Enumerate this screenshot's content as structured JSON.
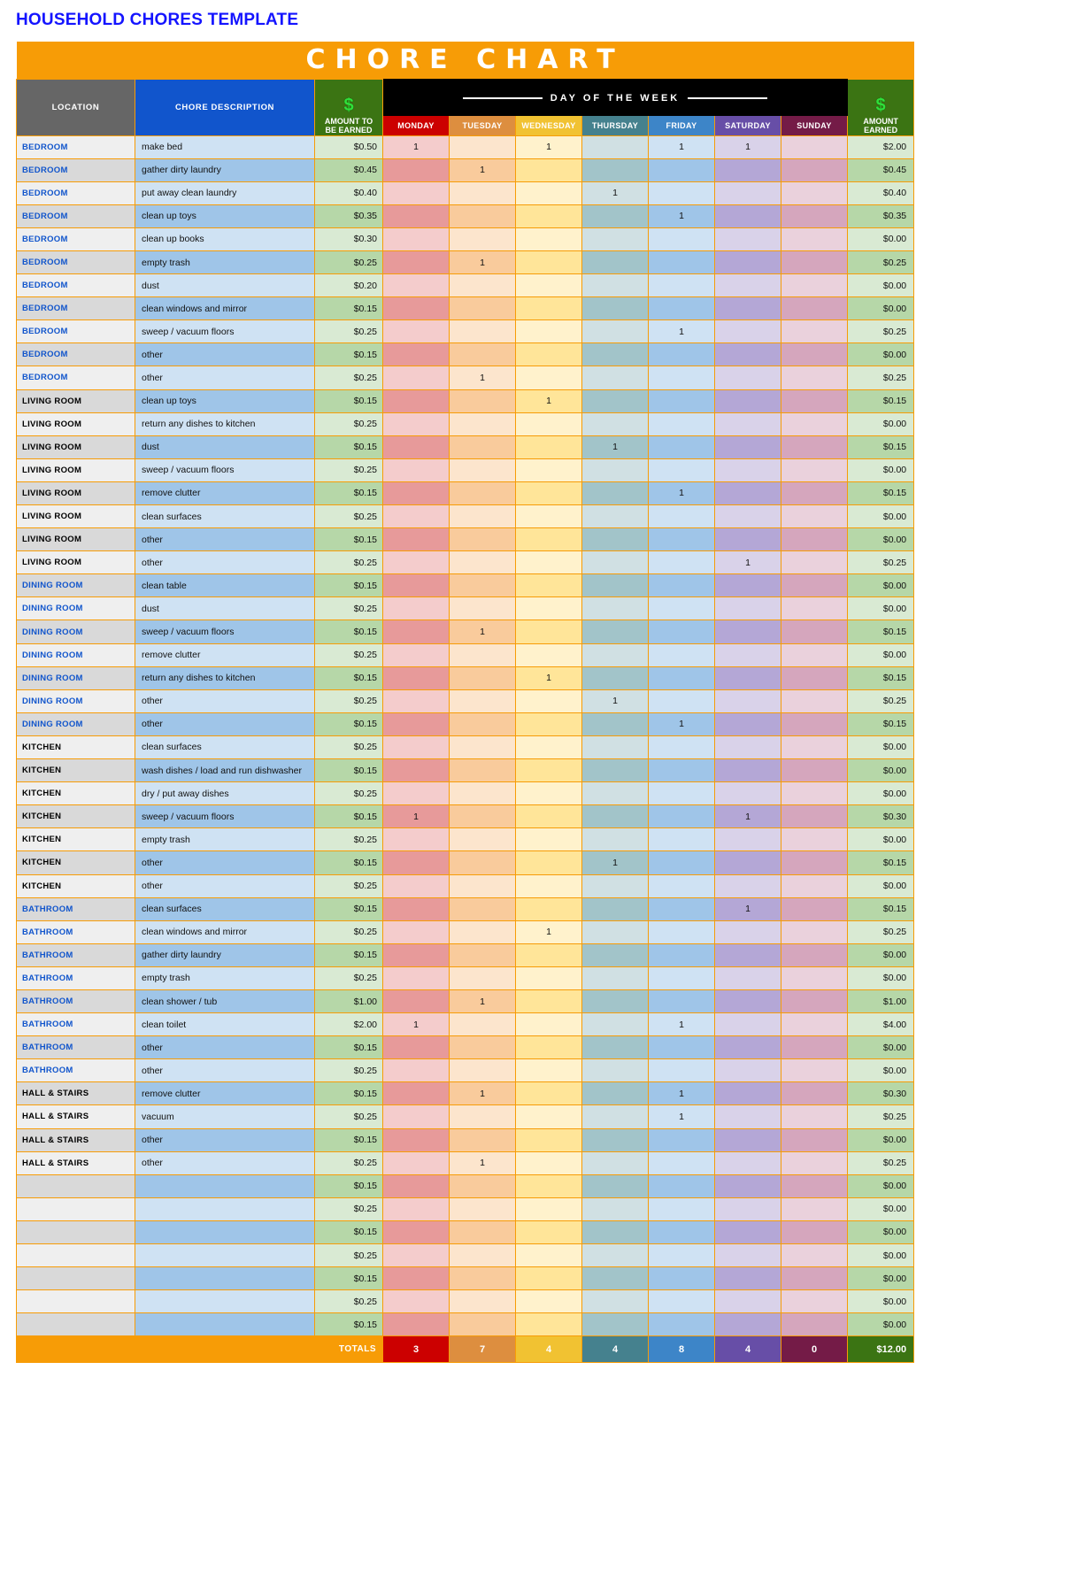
{
  "doc_title": "HOUSEHOLD CHORES TEMPLATE",
  "banner": {
    "title": "CHORE CHART",
    "background": "#f79c06"
  },
  "header": {
    "location": "LOCATION",
    "chore_description": "CHORE DESCRIPTION",
    "amount_to_be_earned_icon": "dollar-sign",
    "amount_to_be_earned_line1": "AMOUNT TO",
    "amount_to_be_earned_line2": "BE EARNED",
    "day_of_week_band": "DAY OF THE WEEK",
    "amount_earned_icon": "dollar-sign",
    "amount_earned_line1": "AMOUNT",
    "amount_earned_line2": "EARNED",
    "days": [
      {
        "label": "MONDAY",
        "color": "#cc0000"
      },
      {
        "label": "TUESDAY",
        "color": "#dd8e3f"
      },
      {
        "label": "WEDNESDAY",
        "color": "#f1c232"
      },
      {
        "label": "THURSDAY",
        "color": "#45818e"
      },
      {
        "label": "FRIDAY",
        "color": "#3d85c8"
      },
      {
        "label": "SATURDAY",
        "color": "#674ea7"
      },
      {
        "label": "SUNDAY",
        "color": "#741b47"
      }
    ]
  },
  "colors": {
    "title_blue": "#1414ff",
    "orange": "#f79c06",
    "grey_header": "#666666",
    "blue_header": "#1155cc",
    "green_header": "#3b7413",
    "black_band": "#000000"
  },
  "rows": [
    {
      "location": "BEDROOM",
      "loc_color": "#1155cc",
      "desc": "make bed",
      "amount": "$0.50",
      "days": [
        "1",
        "",
        "1",
        "",
        "1",
        "1",
        ""
      ],
      "earned": "$2.00"
    },
    {
      "location": "BEDROOM",
      "loc_color": "#1155cc",
      "desc": "gather dirty laundry",
      "amount": "$0.45",
      "days": [
        "",
        "1",
        "",
        "",
        "",
        "",
        ""
      ],
      "earned": "$0.45"
    },
    {
      "location": "BEDROOM",
      "loc_color": "#1155cc",
      "desc": "put away clean laundry",
      "amount": "$0.40",
      "days": [
        "",
        "",
        "",
        "1",
        "",
        "",
        ""
      ],
      "earned": "$0.40"
    },
    {
      "location": "BEDROOM",
      "loc_color": "#1155cc",
      "desc": "clean up toys",
      "amount": "$0.35",
      "days": [
        "",
        "",
        "",
        "",
        "1",
        "",
        ""
      ],
      "earned": "$0.35"
    },
    {
      "location": "BEDROOM",
      "loc_color": "#1155cc",
      "desc": "clean up books",
      "amount": "$0.30",
      "days": [
        "",
        "",
        "",
        "",
        "",
        "",
        ""
      ],
      "earned": "$0.00"
    },
    {
      "location": "BEDROOM",
      "loc_color": "#1155cc",
      "desc": "empty trash",
      "amount": "$0.25",
      "days": [
        "",
        "1",
        "",
        "",
        "",
        "",
        ""
      ],
      "earned": "$0.25"
    },
    {
      "location": "BEDROOM",
      "loc_color": "#1155cc",
      "desc": "dust",
      "amount": "$0.20",
      "days": [
        "",
        "",
        "",
        "",
        "",
        "",
        ""
      ],
      "earned": "$0.00"
    },
    {
      "location": "BEDROOM",
      "loc_color": "#1155cc",
      "desc": "clean windows and mirror",
      "amount": "$0.15",
      "days": [
        "",
        "",
        "",
        "",
        "",
        "",
        ""
      ],
      "earned": "$0.00"
    },
    {
      "location": "BEDROOM",
      "loc_color": "#1155cc",
      "desc": "sweep / vacuum floors",
      "amount": "$0.25",
      "days": [
        "",
        "",
        "",
        "",
        "1",
        "",
        ""
      ],
      "earned": "$0.25"
    },
    {
      "location": "BEDROOM",
      "loc_color": "#1155cc",
      "desc": "other",
      "amount": "$0.15",
      "days": [
        "",
        "",
        "",
        "",
        "",
        "",
        ""
      ],
      "earned": "$0.00"
    },
    {
      "location": "BEDROOM",
      "loc_color": "#1155cc",
      "desc": "other",
      "amount": "$0.25",
      "days": [
        "",
        "1",
        "",
        "",
        "",
        "",
        ""
      ],
      "earned": "$0.25"
    },
    {
      "location": "LIVING ROOM",
      "loc_color": "#000000",
      "desc": "clean up toys",
      "amount": "$0.15",
      "days": [
        "",
        "",
        "1",
        "",
        "",
        "",
        ""
      ],
      "earned": "$0.15"
    },
    {
      "location": "LIVING ROOM",
      "loc_color": "#000000",
      "desc": "return any dishes to kitchen",
      "amount": "$0.25",
      "days": [
        "",
        "",
        "",
        "",
        "",
        "",
        ""
      ],
      "earned": "$0.00"
    },
    {
      "location": "LIVING ROOM",
      "loc_color": "#000000",
      "desc": "dust",
      "amount": "$0.15",
      "days": [
        "",
        "",
        "",
        "1",
        "",
        "",
        ""
      ],
      "earned": "$0.15"
    },
    {
      "location": "LIVING ROOM",
      "loc_color": "#000000",
      "desc": "sweep / vacuum floors",
      "amount": "$0.25",
      "days": [
        "",
        "",
        "",
        "",
        "",
        "",
        ""
      ],
      "earned": "$0.00"
    },
    {
      "location": "LIVING ROOM",
      "loc_color": "#000000",
      "desc": "remove clutter",
      "amount": "$0.15",
      "days": [
        "",
        "",
        "",
        "",
        "1",
        "",
        ""
      ],
      "earned": "$0.15"
    },
    {
      "location": "LIVING ROOM",
      "loc_color": "#000000",
      "desc": "clean surfaces",
      "amount": "$0.25",
      "days": [
        "",
        "",
        "",
        "",
        "",
        "",
        ""
      ],
      "earned": "$0.00"
    },
    {
      "location": "LIVING ROOM",
      "loc_color": "#000000",
      "desc": "other",
      "amount": "$0.15",
      "days": [
        "",
        "",
        "",
        "",
        "",
        "",
        ""
      ],
      "earned": "$0.00"
    },
    {
      "location": "LIVING ROOM",
      "loc_color": "#000000",
      "desc": "other",
      "amount": "$0.25",
      "days": [
        "",
        "",
        "",
        "",
        "",
        "1",
        ""
      ],
      "earned": "$0.25"
    },
    {
      "location": "DINING ROOM",
      "loc_color": "#1155cc",
      "desc": "clean table",
      "amount": "$0.15",
      "days": [
        "",
        "",
        "",
        "",
        "",
        "",
        ""
      ],
      "earned": "$0.00"
    },
    {
      "location": "DINING ROOM",
      "loc_color": "#1155cc",
      "desc": "dust",
      "amount": "$0.25",
      "days": [
        "",
        "",
        "",
        "",
        "",
        "",
        ""
      ],
      "earned": "$0.00"
    },
    {
      "location": "DINING ROOM",
      "loc_color": "#1155cc",
      "desc": "sweep / vacuum floors",
      "amount": "$0.15",
      "days": [
        "",
        "1",
        "",
        "",
        "",
        "",
        ""
      ],
      "earned": "$0.15"
    },
    {
      "location": "DINING ROOM",
      "loc_color": "#1155cc",
      "desc": "remove clutter",
      "amount": "$0.25",
      "days": [
        "",
        "",
        "",
        "",
        "",
        "",
        ""
      ],
      "earned": "$0.00"
    },
    {
      "location": "DINING ROOM",
      "loc_color": "#1155cc",
      "desc": "return any dishes to kitchen",
      "amount": "$0.15",
      "days": [
        "",
        "",
        "1",
        "",
        "",
        "",
        ""
      ],
      "earned": "$0.15"
    },
    {
      "location": "DINING ROOM",
      "loc_color": "#1155cc",
      "desc": "other",
      "amount": "$0.25",
      "days": [
        "",
        "",
        "",
        "1",
        "",
        "",
        ""
      ],
      "earned": "$0.25"
    },
    {
      "location": "DINING ROOM",
      "loc_color": "#1155cc",
      "desc": "other",
      "amount": "$0.15",
      "days": [
        "",
        "",
        "",
        "",
        "1",
        "",
        ""
      ],
      "earned": "$0.15"
    },
    {
      "location": "KITCHEN",
      "loc_color": "#000000",
      "desc": "clean surfaces",
      "amount": "$0.25",
      "days": [
        "",
        "",
        "",
        "",
        "",
        "",
        ""
      ],
      "earned": "$0.00"
    },
    {
      "location": "KITCHEN",
      "loc_color": "#000000",
      "desc": "wash dishes / load and run dishwasher",
      "amount": "$0.15",
      "days": [
        "",
        "",
        "",
        "",
        "",
        "",
        ""
      ],
      "earned": "$0.00"
    },
    {
      "location": "KITCHEN",
      "loc_color": "#000000",
      "desc": "dry / put away dishes",
      "amount": "$0.25",
      "days": [
        "",
        "",
        "",
        "",
        "",
        "",
        ""
      ],
      "earned": "$0.00"
    },
    {
      "location": "KITCHEN",
      "loc_color": "#000000",
      "desc": "sweep / vacuum floors",
      "amount": "$0.15",
      "days": [
        "1",
        "",
        "",
        "",
        "",
        "1",
        ""
      ],
      "earned": "$0.30"
    },
    {
      "location": "KITCHEN",
      "loc_color": "#000000",
      "desc": "empty trash",
      "amount": "$0.25",
      "days": [
        "",
        "",
        "",
        "",
        "",
        "",
        ""
      ],
      "earned": "$0.00"
    },
    {
      "location": "KITCHEN",
      "loc_color": "#000000",
      "desc": "other",
      "amount": "$0.15",
      "days": [
        "",
        "",
        "",
        "1",
        "",
        "",
        ""
      ],
      "earned": "$0.15"
    },
    {
      "location": "KITCHEN",
      "loc_color": "#000000",
      "desc": "other",
      "amount": "$0.25",
      "days": [
        "",
        "",
        "",
        "",
        "",
        "",
        ""
      ],
      "earned": "$0.00"
    },
    {
      "location": "BATHROOM",
      "loc_color": "#1155cc",
      "desc": "clean surfaces",
      "amount": "$0.15",
      "days": [
        "",
        "",
        "",
        "",
        "",
        "1",
        ""
      ],
      "earned": "$0.15"
    },
    {
      "location": "BATHROOM",
      "loc_color": "#1155cc",
      "desc": "clean windows and mirror",
      "amount": "$0.25",
      "days": [
        "",
        "",
        "1",
        "",
        "",
        "",
        ""
      ],
      "earned": "$0.25"
    },
    {
      "location": "BATHROOM",
      "loc_color": "#1155cc",
      "desc": "gather dirty laundry",
      "amount": "$0.15",
      "days": [
        "",
        "",
        "",
        "",
        "",
        "",
        ""
      ],
      "earned": "$0.00"
    },
    {
      "location": "BATHROOM",
      "loc_color": "#1155cc",
      "desc": "empty trash",
      "amount": "$0.25",
      "days": [
        "",
        "",
        "",
        "",
        "",
        "",
        ""
      ],
      "earned": "$0.00"
    },
    {
      "location": "BATHROOM",
      "loc_color": "#1155cc",
      "desc": "clean shower / tub",
      "amount": "$1.00",
      "days": [
        "",
        "1",
        "",
        "",
        "",
        "",
        ""
      ],
      "earned": "$1.00"
    },
    {
      "location": "BATHROOM",
      "loc_color": "#1155cc",
      "desc": "clean toilet",
      "amount": "$2.00",
      "days": [
        "1",
        "",
        "",
        "",
        "1",
        "",
        ""
      ],
      "earned": "$4.00"
    },
    {
      "location": "BATHROOM",
      "loc_color": "#1155cc",
      "desc": "other",
      "amount": "$0.15",
      "days": [
        "",
        "",
        "",
        "",
        "",
        "",
        ""
      ],
      "earned": "$0.00"
    },
    {
      "location": "BATHROOM",
      "loc_color": "#1155cc",
      "desc": "other",
      "amount": "$0.25",
      "days": [
        "",
        "",
        "",
        "",
        "",
        "",
        ""
      ],
      "earned": "$0.00"
    },
    {
      "location": "HALL & STAIRS",
      "loc_color": "#000000",
      "desc": "remove clutter",
      "amount": "$0.15",
      "days": [
        "",
        "1",
        "",
        "",
        "1",
        "",
        ""
      ],
      "earned": "$0.30"
    },
    {
      "location": "HALL & STAIRS",
      "loc_color": "#000000",
      "desc": "vacuum",
      "amount": "$0.25",
      "days": [
        "",
        "",
        "",
        "",
        "1",
        "",
        ""
      ],
      "earned": "$0.25"
    },
    {
      "location": "HALL & STAIRS",
      "loc_color": "#000000",
      "desc": "other",
      "amount": "$0.15",
      "days": [
        "",
        "",
        "",
        "",
        "",
        "",
        ""
      ],
      "earned": "$0.00"
    },
    {
      "location": "HALL & STAIRS",
      "loc_color": "#000000",
      "desc": "other",
      "amount": "$0.25",
      "days": [
        "",
        "1",
        "",
        "",
        "",
        "",
        ""
      ],
      "earned": "$0.25"
    },
    {
      "location": "",
      "loc_color": "#000000",
      "desc": "",
      "amount": "$0.15",
      "days": [
        "",
        "",
        "",
        "",
        "",
        "",
        ""
      ],
      "earned": "$0.00"
    },
    {
      "location": "",
      "loc_color": "#000000",
      "desc": "",
      "amount": "$0.25",
      "days": [
        "",
        "",
        "",
        "",
        "",
        "",
        ""
      ],
      "earned": "$0.00"
    },
    {
      "location": "",
      "loc_color": "#000000",
      "desc": "",
      "amount": "$0.15",
      "days": [
        "",
        "",
        "",
        "",
        "",
        "",
        ""
      ],
      "earned": "$0.00"
    },
    {
      "location": "",
      "loc_color": "#000000",
      "desc": "",
      "amount": "$0.25",
      "days": [
        "",
        "",
        "",
        "",
        "",
        "",
        ""
      ],
      "earned": "$0.00"
    },
    {
      "location": "",
      "loc_color": "#000000",
      "desc": "",
      "amount": "$0.15",
      "days": [
        "",
        "",
        "",
        "",
        "",
        "",
        ""
      ],
      "earned": "$0.00"
    },
    {
      "location": "",
      "loc_color": "#000000",
      "desc": "",
      "amount": "$0.25",
      "days": [
        "",
        "",
        "",
        "",
        "",
        "",
        ""
      ],
      "earned": "$0.00"
    },
    {
      "location": "",
      "loc_color": "#000000",
      "desc": "",
      "amount": "$0.15",
      "days": [
        "",
        "",
        "",
        "",
        "",
        "",
        ""
      ],
      "earned": "$0.00"
    }
  ],
  "totals": {
    "label": "TOTALS",
    "days": [
      "3",
      "7",
      "4",
      "4",
      "8",
      "4",
      "0"
    ],
    "amount_earned": "$12.00"
  }
}
